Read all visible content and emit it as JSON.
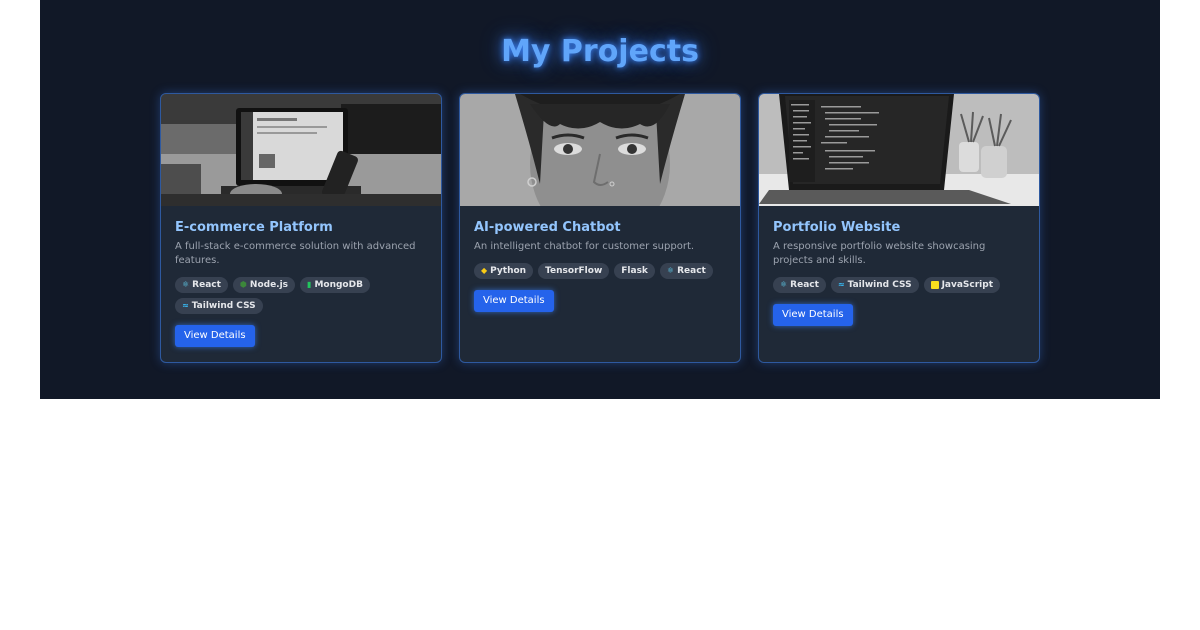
{
  "section": {
    "title": "My Projects"
  },
  "projects": [
    {
      "title": "E-commerce Platform",
      "description": "A full-stack e-commerce solution with advanced features.",
      "tags": [
        {
          "label": "React",
          "icon": "react-icon"
        },
        {
          "label": "Node.js",
          "icon": "nodejs-icon"
        },
        {
          "label": "MongoDB",
          "icon": "mongodb-icon"
        },
        {
          "label": "Tailwind CSS",
          "icon": "tailwind-icon"
        }
      ],
      "button_label": "View Details",
      "image": "laptop-and-phone-photo"
    },
    {
      "title": "AI-powered Chatbot",
      "description": "An intelligent chatbot for customer support.",
      "tags": [
        {
          "label": "Python",
          "icon": "python-icon"
        },
        {
          "label": "TensorFlow",
          "icon": ""
        },
        {
          "label": "Flask",
          "icon": ""
        },
        {
          "label": "React",
          "icon": "react-icon"
        }
      ],
      "button_label": "View Details",
      "image": "woman-portrait-photo"
    },
    {
      "title": "Portfolio Website",
      "description": "A responsive portfolio website showcasing projects and skills.",
      "tags": [
        {
          "label": "React",
          "icon": "react-icon"
        },
        {
          "label": "Tailwind CSS",
          "icon": "tailwind-icon"
        },
        {
          "label": "JavaScript",
          "icon": "javascript-icon"
        }
      ],
      "button_label": "View Details",
      "image": "laptop-code-editor-photo"
    }
  ],
  "colors": {
    "background": "#111827",
    "card": "#1f2937",
    "accent": "#2563eb",
    "title_glow": "#60a5fa",
    "card_title": "#93c5fd",
    "tag": "#374151"
  }
}
